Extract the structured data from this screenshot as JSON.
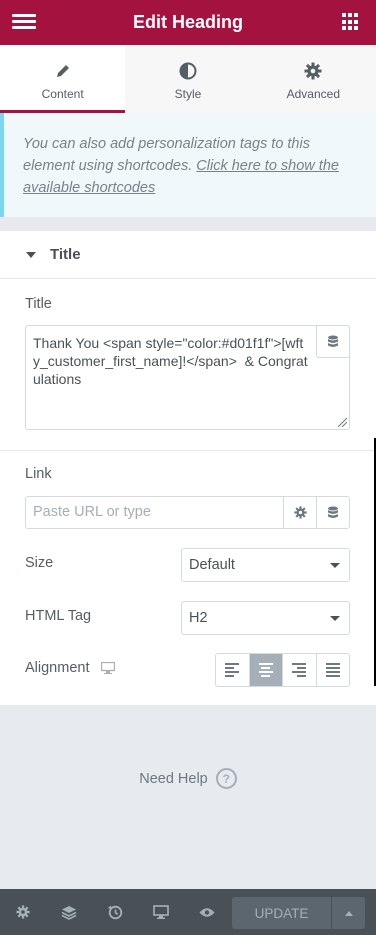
{
  "header": {
    "title": "Edit Heading",
    "menu_icon": "hamburger-icon",
    "apps_icon": "grid-icon"
  },
  "tabs": [
    {
      "label": "Content",
      "icon": "pencil-icon",
      "active": true
    },
    {
      "label": "Style",
      "icon": "contrast-icon",
      "active": false
    },
    {
      "label": "Advanced",
      "icon": "gear-icon",
      "active": false
    }
  ],
  "notice": {
    "text": "You can also add personalization tags to this element using shortcodes. ",
    "link": "Click here to show the available shortcodes"
  },
  "section": {
    "title": "Title"
  },
  "fields": {
    "title_label": "Title",
    "title_value": "Thank You <span style=\"color:#d01f1f\">[wfty_customer_first_name]!</span>  & Congratulations",
    "link_label": "Link",
    "link_placeholder": "Paste URL or type",
    "size_label": "Size",
    "size_value": "Default",
    "html_tag_label": "HTML Tag",
    "html_tag_value": "H2",
    "alignment_label": "Alignment",
    "alignment_options": [
      "left",
      "center",
      "right",
      "justify"
    ],
    "alignment_selected": "center"
  },
  "help": {
    "label": "Need Help",
    "icon": "question-icon"
  },
  "footer": {
    "icons": [
      "gear-icon",
      "layers-icon",
      "history-icon",
      "desktop-icon",
      "eye-icon"
    ],
    "update_label": "UPDATE"
  },
  "colors": {
    "brand": "#a4123f",
    "footer": "#495157",
    "notice_border": "#7fd4ee"
  }
}
